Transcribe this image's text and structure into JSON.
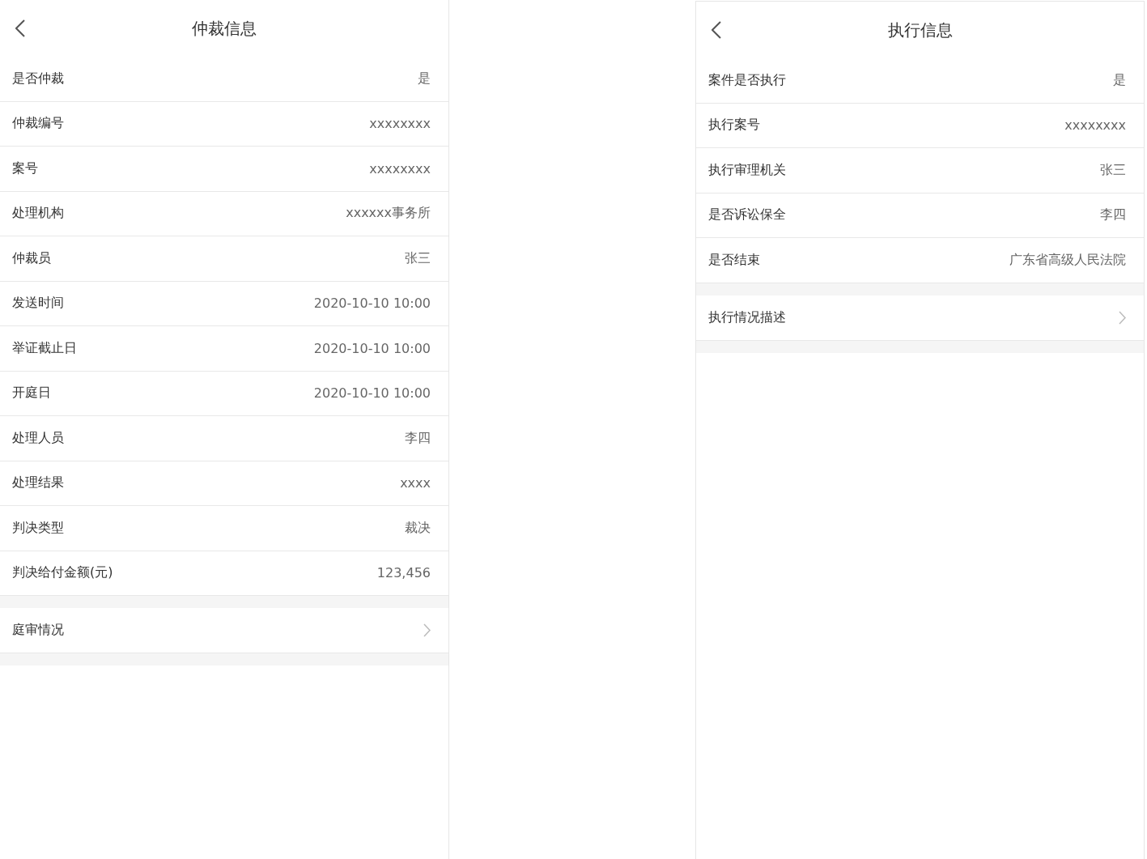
{
  "panels": [
    {
      "title": "仲裁信息",
      "rows": [
        {
          "label": "是否仲裁",
          "value": "是"
        },
        {
          "label": "仲裁编号",
          "value": "xxxxxxxx"
        },
        {
          "label": "案号",
          "value": "xxxxxxxx"
        },
        {
          "label": "处理机构",
          "value": "xxxxxx事务所"
        },
        {
          "label": "仲裁员",
          "value": "张三"
        },
        {
          "label": "发送时间",
          "value": "2020-10-10 10:00"
        },
        {
          "label": "举证截止日",
          "value": "2020-10-10 10:00"
        },
        {
          "label": "开庭日",
          "value": "2020-10-10 10:00"
        },
        {
          "label": "处理人员",
          "value": "李四"
        },
        {
          "label": "处理结果",
          "value": "xxxx"
        },
        {
          "label": "判决类型",
          "value": "裁决"
        },
        {
          "label": "判决给付金额(元)",
          "value": "123,456"
        }
      ],
      "link": "庭审情况"
    },
    {
      "title": "执行信息",
      "rows": [
        {
          "label": "案件是否执行",
          "value": "是"
        },
        {
          "label": "执行案号",
          "value": "xxxxxxxx"
        },
        {
          "label": "执行审理机关",
          "value": "张三"
        },
        {
          "label": "是否诉讼保全",
          "value": "李四"
        },
        {
          "label": "是否结束",
          "value": "广东省高级人民法院"
        }
      ],
      "link": "执行情况描述"
    }
  ]
}
